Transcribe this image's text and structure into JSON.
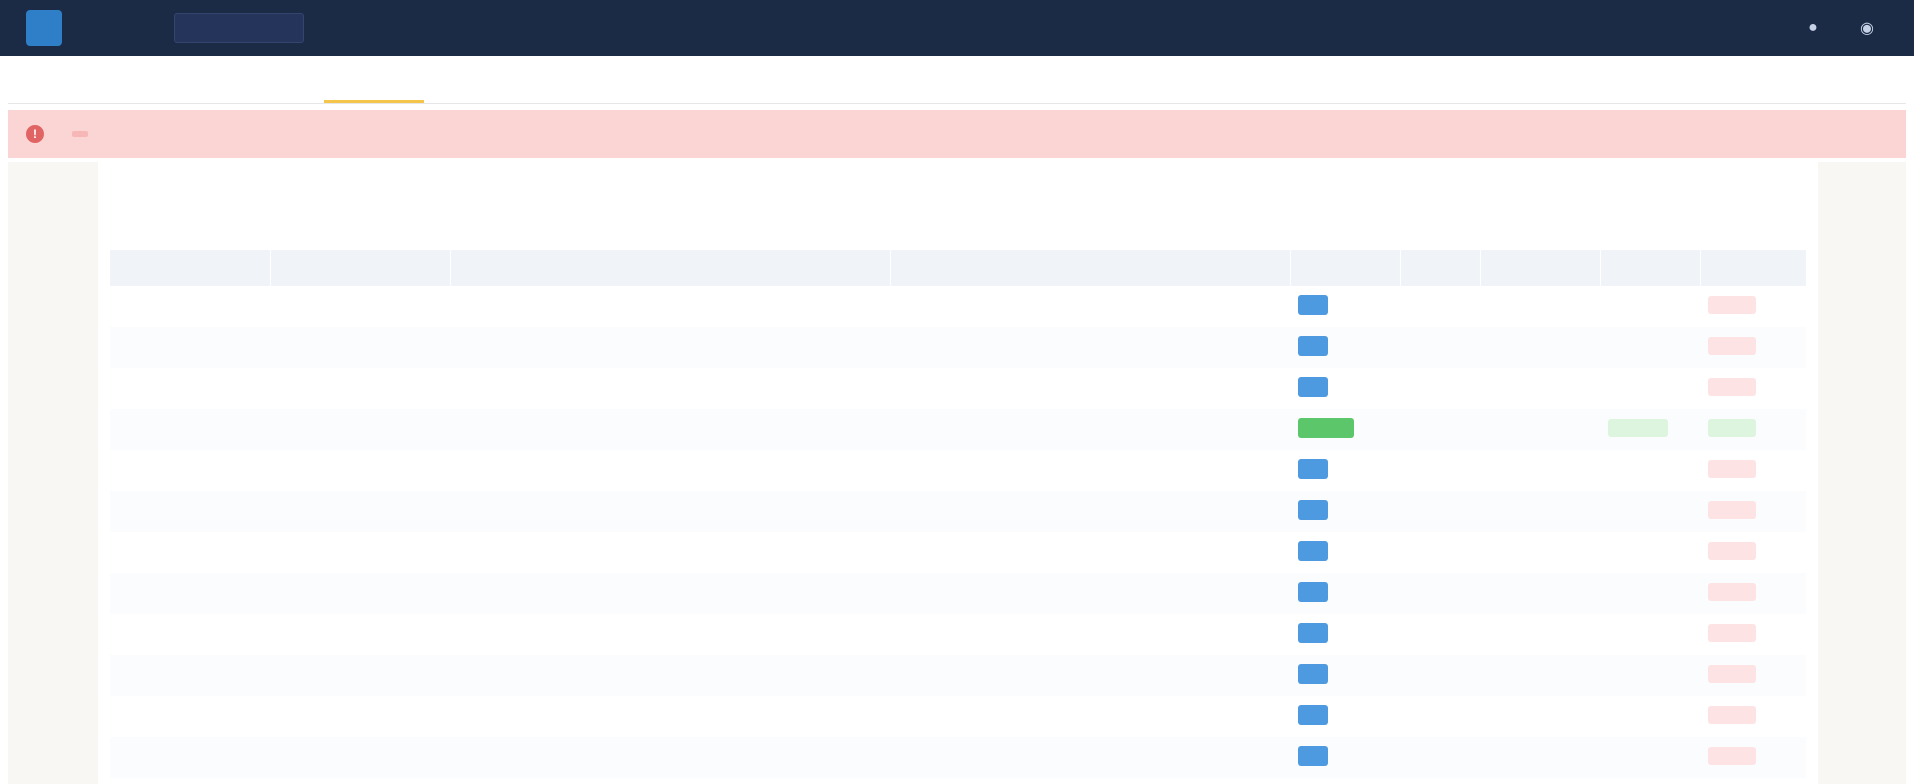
{
  "header": {
    "logo_letter": "",
    "app_name": "",
    "search_placeholder": "",
    "links": [
      "",
      "",
      "",
      ""
    ],
    "icons": [
      "bell-icon",
      "user-icon"
    ]
  },
  "tabs": [
    {
      "label": "",
      "active": false
    },
    {
      "label": "",
      "active": false
    },
    {
      "label": "",
      "active": false
    },
    {
      "label": "",
      "active": true
    }
  ],
  "alert": {
    "text": "",
    "link": ""
  },
  "page": {
    "title": ""
  },
  "table": {
    "columns": [
      "",
      "",
      "",
      "",
      "",
      "",
      "",
      "",
      ""
    ],
    "rows": [
      {
        "c1": "",
        "c2": "",
        "c3": "",
        "c4": "",
        "status": "",
        "status_color": "blue",
        "c6": "",
        "c7": "",
        "c8": "",
        "c8_style": "blue",
        "action": "",
        "action_style": "red"
      },
      {
        "c1": "",
        "c2": "",
        "c3": "",
        "c4": "",
        "status": "",
        "status_color": "blue",
        "c6": "",
        "c7": "",
        "c8": "",
        "c8_style": "blue",
        "action": "",
        "action_style": "red"
      },
      {
        "c1": "",
        "c2": "",
        "c3": "",
        "c4": "",
        "status": "",
        "status_color": "blue",
        "c6": "",
        "c7": "",
        "c8": "",
        "c8_style": "blue",
        "action": "",
        "action_style": "red"
      },
      {
        "c1": "",
        "c2": "",
        "c3": "",
        "c4": "",
        "status": "",
        "status_color": "green",
        "c6": "",
        "c7": "",
        "c8": "",
        "c8_style": "green",
        "action": "",
        "action_style": "green"
      },
      {
        "c1": "",
        "c2": "",
        "c3": "",
        "c4": "",
        "status": "",
        "status_color": "blue",
        "c6": "",
        "c7": "",
        "c8": "",
        "c8_style": "blue",
        "action": "",
        "action_style": "red"
      },
      {
        "c1": "",
        "c2": "",
        "c3": "",
        "c4": "",
        "status": "",
        "status_color": "blue",
        "c6": "",
        "c7": "",
        "c8": "",
        "c8_style": "blue",
        "action": "",
        "action_style": "red"
      },
      {
        "c1": "",
        "c2": "",
        "c3": "",
        "c4": "",
        "status": "",
        "status_color": "blue",
        "c6": "",
        "c7": "",
        "c8": "",
        "c8_style": "blue",
        "action": "",
        "action_style": "red"
      },
      {
        "c1": "",
        "c2": "",
        "c3": "",
        "c4": "",
        "status": "",
        "status_color": "blue",
        "c6": "",
        "c7": "",
        "c8": "",
        "c8_style": "blue",
        "action": "",
        "action_style": "red"
      },
      {
        "c1": "",
        "c2": "",
        "c3": "",
        "c4": "",
        "status": "",
        "status_color": "blue",
        "c6": "",
        "c7": "",
        "c8": "",
        "c8_style": "blue",
        "action": "",
        "action_style": "red"
      },
      {
        "c1": "",
        "c2": "",
        "c3": "",
        "c4": "",
        "status": "",
        "status_color": "blue",
        "c6": "",
        "c7": "",
        "c8": "",
        "c8_style": "blue",
        "action": "",
        "action_style": "red"
      },
      {
        "c1": "",
        "c2": "",
        "c3": "",
        "c4": "",
        "status": "",
        "status_color": "blue",
        "c6": "",
        "c7": "",
        "c8": "",
        "c8_style": "blue",
        "action": "",
        "action_style": "red"
      },
      {
        "c1": "",
        "c2": "",
        "c3": "",
        "c4": "",
        "status": "",
        "status_color": "blue",
        "c6": "",
        "c7": "",
        "c8": "",
        "c8_style": "blue",
        "action": "",
        "action_style": "red"
      }
    ]
  },
  "colors": {
    "header_bg": "#1b2a45",
    "alert_bg": "#fbd4d4",
    "status_blue": "#4e9ae0",
    "status_green": "#5cc76a",
    "action_red": "#d9534f",
    "tab_active": "#f5c54a"
  }
}
